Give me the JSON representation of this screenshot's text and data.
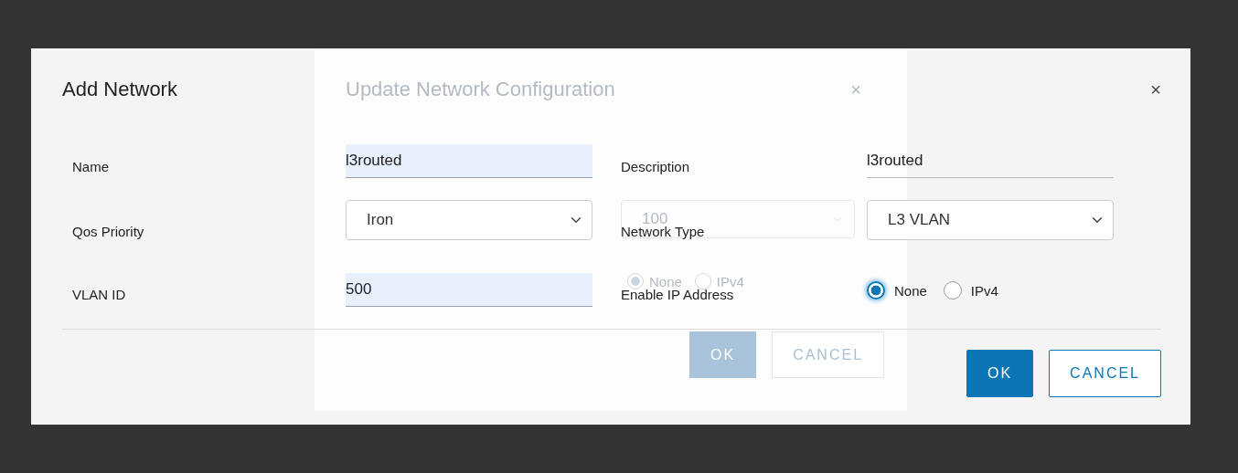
{
  "dialog": {
    "title": "Add Network",
    "close": "×",
    "fields": [
      {
        "label": "Name",
        "kind": "text",
        "value": "l3routed",
        "autofilled": true
      },
      {
        "label": "Description",
        "kind": "text",
        "value": "l3routed",
        "autofilled": false
      },
      {
        "label": "Qos Priority",
        "kind": "select",
        "value": "Iron"
      },
      {
        "label": "Network Type",
        "kind": "select",
        "value": "L3 VLAN"
      },
      {
        "label": "VLAN ID",
        "kind": "text",
        "value": "500",
        "autofilled": true
      },
      {
        "label": "Enable IP Address",
        "kind": "radio",
        "options": [
          {
            "label": "None",
            "selected": true
          },
          {
            "label": "IPv4",
            "selected": false
          }
        ]
      }
    ],
    "buttons": [
      {
        "label": "OK",
        "primary": true
      },
      {
        "label": "CANCEL",
        "primary": false
      }
    ]
  },
  "background_dialog": {
    "title": "Update Network Configuration",
    "close": "×",
    "select_value": "100",
    "radios": [
      {
        "label": "None",
        "selected": true
      },
      {
        "label": "IPv4",
        "selected": false
      }
    ],
    "buttons": [
      {
        "label": "OK",
        "primary": true
      },
      {
        "label": "CANCEL",
        "primary": false
      }
    ]
  }
}
